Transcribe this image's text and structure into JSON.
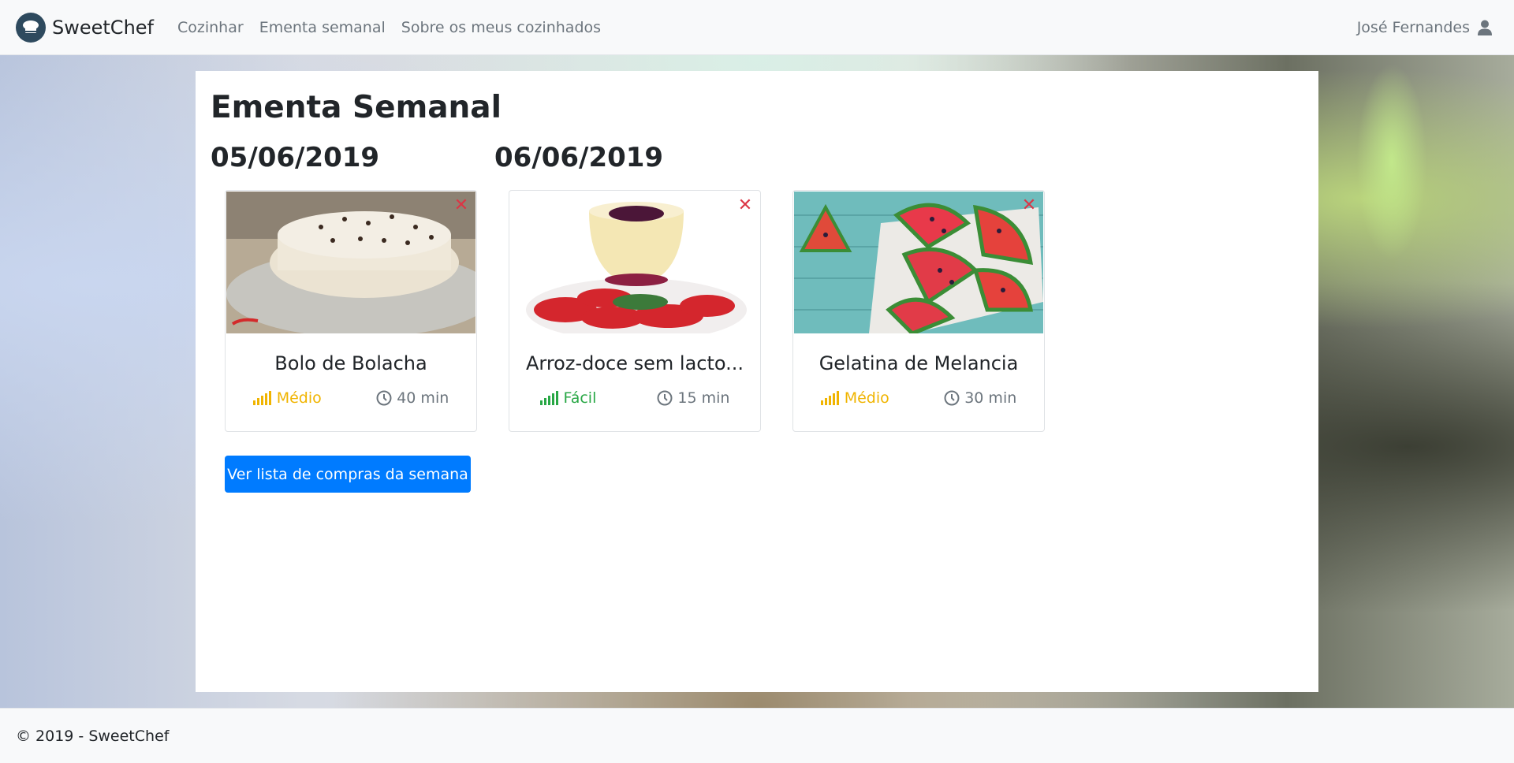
{
  "navbar": {
    "brand": "SweetChef",
    "links": [
      "Cozinhar",
      "Ementa semanal",
      "Sobre os meus cozinhados"
    ],
    "user_name": "José Fernandes"
  },
  "page": {
    "title": "Ementa Semanal",
    "days": [
      {
        "date": "05/06/2019"
      },
      {
        "date": "06/06/2019"
      }
    ],
    "recipes": [
      {
        "name": "Bolo de Bolacha",
        "difficulty": "Médio",
        "time": "40 min",
        "difficulty_color": "#f0b400"
      },
      {
        "name": "Arroz-doce sem lacto...",
        "difficulty": "Fácil",
        "time": "15 min",
        "difficulty_color": "#28a745"
      },
      {
        "name": "Gelatina de Melancia",
        "difficulty": "Médio",
        "time": "30 min",
        "difficulty_color": "#f0b400"
      }
    ],
    "shopping_button": "Ver lista de compras da semana"
  },
  "footer": {
    "text": "© 2019 - SweetChef"
  },
  "colors": {
    "primary": "#007bff",
    "danger": "#dc3545",
    "medium": "#f0b400",
    "easy": "#28a745"
  },
  "icons": {
    "brand": "chef-hat-icon",
    "user": "user-icon",
    "remove": "close-icon",
    "difficulty": "signal-bars-icon",
    "time": "clock-icon"
  }
}
